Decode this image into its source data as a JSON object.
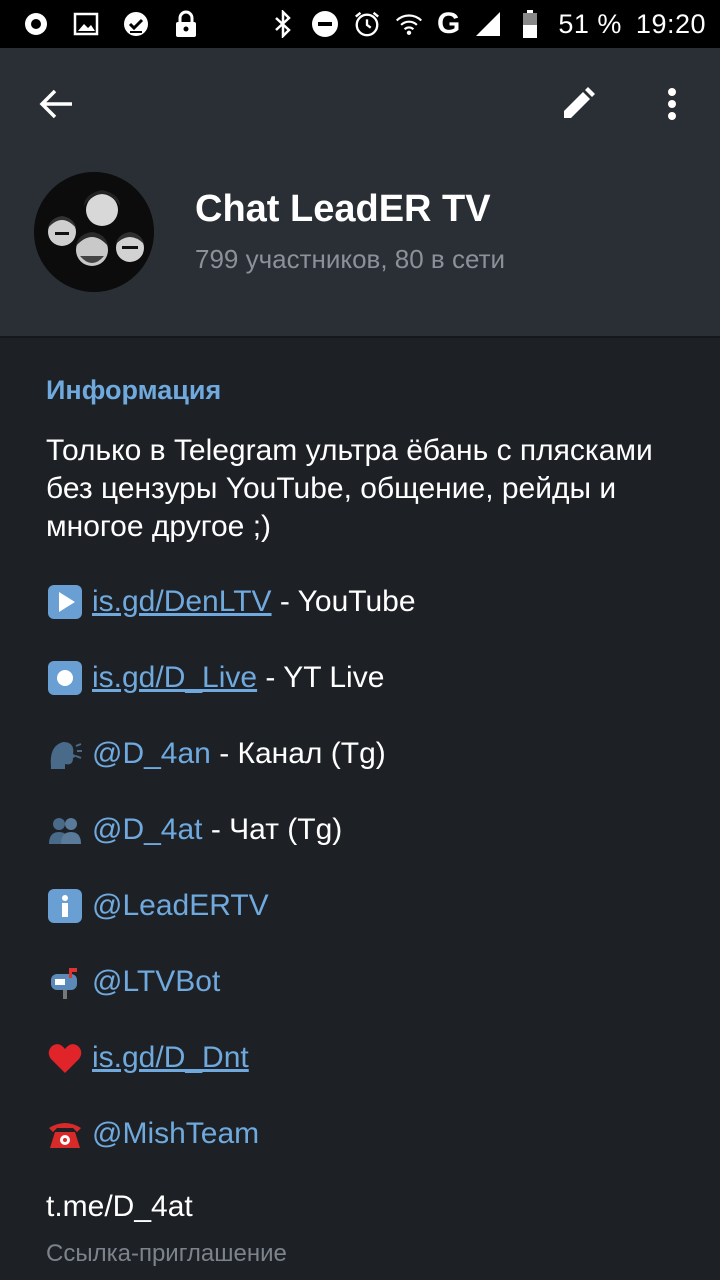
{
  "status_bar": {
    "battery": "51 %",
    "time": "19:20",
    "network": "G",
    "icons_left": [
      "record-icon",
      "image-icon",
      "check-icon",
      "lock-icon"
    ],
    "icons_right": [
      "bluetooth-icon",
      "dnd-icon",
      "alarm-icon",
      "wifi-icon",
      "signal-icon",
      "battery-icon"
    ]
  },
  "header": {
    "title": "Chat LeadER TV",
    "subtitle": "799 участников, 80 в сети"
  },
  "info": {
    "section_title": "Информация",
    "description": "Только в Telegram ультра ёбань с плясками без цензуры YouTube, общение, рейды и многое другое ;)",
    "rows": [
      {
        "emoji": "play-emoji",
        "link": "is.gd/DenLTV",
        "text": " - YouTube"
      },
      {
        "emoji": "record-emoji",
        "link": "is.gd/D_Live",
        "text": " - YT Live"
      },
      {
        "emoji": "speaking-head-emoji",
        "link": "@D_4an",
        "text": " - Канал (Tg)"
      },
      {
        "emoji": "two-people-emoji",
        "link": "@D_4at",
        "text": " - Чат (Tg)"
      },
      {
        "emoji": "info-emoji",
        "link": "@LeadERTV",
        "text": ""
      },
      {
        "emoji": "mailbox-emoji",
        "link": "@LTVBot",
        "text": ""
      },
      {
        "emoji": "heart-emoji",
        "link": "is.gd/D_Dnt",
        "text": ""
      },
      {
        "emoji": "telephone-emoji",
        "link": "@MishTeam",
        "text": ""
      }
    ],
    "invite_link": "t.me/D_4at",
    "invite_label": "Ссылка-приглашение"
  },
  "colors": {
    "background": "#1d2126",
    "header": "#2a2f35",
    "accent": "#6fa9dd",
    "secondary_text": "#8a9199"
  }
}
